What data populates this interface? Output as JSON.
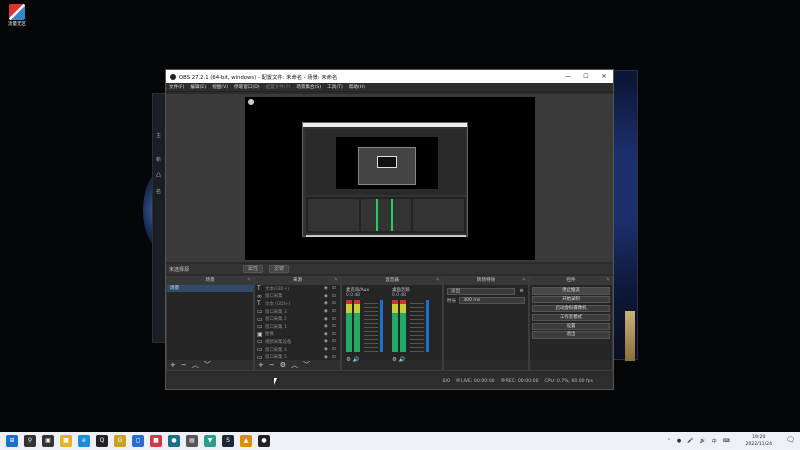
{
  "desktop": {
    "icon_label": "流量无区"
  },
  "background_windows": {
    "left_side_texts": [
      "主",
      "新",
      "凸",
      "名"
    ]
  },
  "obs": {
    "title": "OBS 27.2.1 (64-bit, windows) - 配置文件: 未命名 - 场景: 未命名",
    "controls": {
      "minimize": "—",
      "maximize": "☐",
      "close": "✕"
    },
    "menu": [
      "文件(F)",
      "编辑(E)",
      "视图(V)",
      "停靠窗口(D)",
      "配置文件(P)",
      "场景集合(S)",
      "工具(T)",
      "帮助(H)"
    ],
    "preview_bar": {
      "no_source": "未选择源",
      "properties": "属性",
      "filters": "滤镜"
    },
    "docks": {
      "scenes": {
        "title": "场景",
        "items": [
          "场景"
        ]
      },
      "sources": {
        "title": "来源",
        "items": [
          {
            "type": "T",
            "name": "文本(GDI+)"
          },
          {
            "type": "∞",
            "name": "窗口采集"
          },
          {
            "type": "T",
            "name": "文本 (GDI+)"
          },
          {
            "type": "▭",
            "name": "窗口采集 3"
          },
          {
            "type": "▭",
            "name": "窗口采集 2"
          },
          {
            "type": "▭",
            "name": "窗口采集 1"
          },
          {
            "type": "▣",
            "name": "图像"
          },
          {
            "type": "▭",
            "name": "视频采集设备"
          },
          {
            "type": "▭",
            "name": "窗口采集 4"
          },
          {
            "type": "▭",
            "name": "窗口采集 5"
          },
          {
            "type": "▭",
            "name": "窗口采集 6"
          }
        ]
      },
      "mixer": {
        "title": "混音器",
        "channels": [
          {
            "name": "麦克风/Aux",
            "db": "0.0 dB"
          },
          {
            "name": "桌面音频",
            "db": "0.0 dB"
          }
        ]
      },
      "transitions": {
        "title": "转场特效",
        "type": "淡出",
        "duration_label": "时长",
        "duration": "300 ms"
      },
      "controls": {
        "title": "控件",
        "buttons": [
          "停止推流",
          "开始录制",
          "启动虚拟摄像机",
          "工作室模式",
          "设置",
          "退出"
        ]
      }
    },
    "footer_glyphs": {
      "add": "+",
      "remove": "−",
      "up": "︿",
      "down": "﹀",
      "gear": "⚙"
    },
    "status": {
      "drop": "0/0",
      "live": "LIVE: 00:00:00",
      "rec": "REC: 00:00:00",
      "cpu": "CPU: 0.7%, 60.00 fps"
    }
  },
  "taskbar": {
    "icons": [
      {
        "name": "start-icon",
        "glyph": "⊞",
        "color": "#1b6fd1"
      },
      {
        "name": "search-icon",
        "glyph": "⚲",
        "color": "#333333"
      },
      {
        "name": "taskview-icon",
        "glyph": "▣",
        "color": "#333333"
      },
      {
        "name": "explorer-icon",
        "glyph": "■",
        "color": "#e6b422"
      },
      {
        "name": "edge-icon",
        "glyph": "e",
        "color": "#1a8fd6"
      },
      {
        "name": "qq-icon",
        "glyph": "Q",
        "color": "#222222"
      },
      {
        "name": "app-g-icon",
        "glyph": "G",
        "color": "#c8a220"
      },
      {
        "name": "app-box-icon",
        "glyph": "◻",
        "color": "#2a6dd2"
      },
      {
        "name": "app-red-icon",
        "glyph": "■",
        "color": "#d23a4a"
      },
      {
        "name": "app-circle-icon",
        "glyph": "●",
        "color": "#1c6c8c"
      },
      {
        "name": "app-gray-icon",
        "glyph": "▤",
        "color": "#555555"
      },
      {
        "name": "app-teal-icon",
        "glyph": "▼",
        "color": "#2a9d8f"
      },
      {
        "name": "steam-icon",
        "glyph": "S",
        "color": "#1b2838"
      },
      {
        "name": "app-orange-icon",
        "glyph": "▲",
        "color": "#d98e04"
      },
      {
        "name": "obs-icon",
        "glyph": "●",
        "color": "#222222"
      }
    ],
    "tray": [
      "⌃",
      "●",
      "🎤",
      "🔊",
      "中",
      "⌨"
    ],
    "time": "19:20",
    "date": "2022/11/24",
    "notification": "🗨"
  }
}
